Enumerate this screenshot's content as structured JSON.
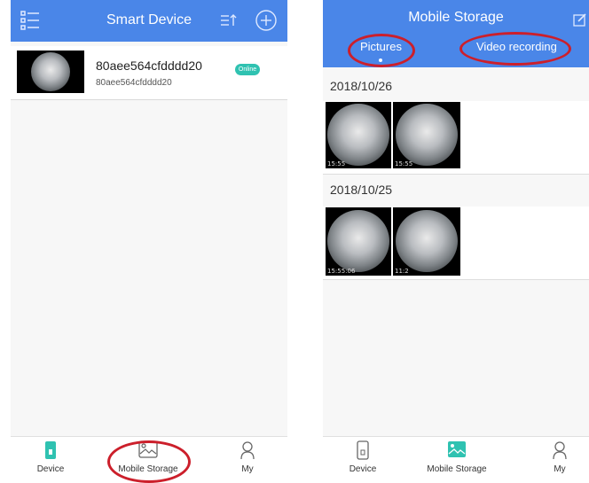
{
  "left": {
    "title": "Smart Device",
    "device": {
      "name": "80aee564cfdddd20",
      "id": "80aee564cfdddd20",
      "status": "Online"
    },
    "tabs": [
      {
        "label": "Device"
      },
      {
        "label": "Mobile Storage"
      },
      {
        "label": "My"
      }
    ]
  },
  "right": {
    "title": "Mobile Storage",
    "subtabs": [
      {
        "label": "Pictures"
      },
      {
        "label": "Video recording"
      }
    ],
    "groups": [
      {
        "date": "2018/10/26",
        "items": [
          {
            "time": "15:55"
          },
          {
            "time": "15:55"
          }
        ]
      },
      {
        "date": "2018/10/25",
        "items": [
          {
            "time": "15:55:06"
          },
          {
            "time": "11:2"
          }
        ]
      }
    ],
    "tabs": [
      {
        "label": "Device"
      },
      {
        "label": "Mobile Storage"
      },
      {
        "label": "My"
      }
    ]
  },
  "colors": {
    "accent": "#4a86e8",
    "online": "#2fc2b1",
    "highlight": "#cc1f2b",
    "storage_icon": "#2fc2b1"
  }
}
